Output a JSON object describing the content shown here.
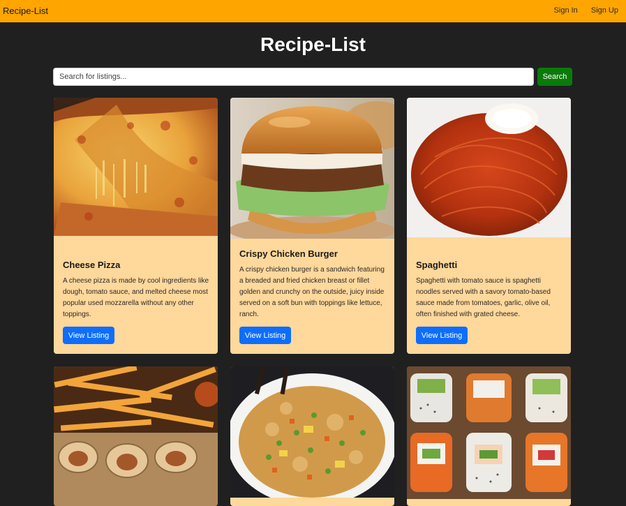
{
  "navbar": {
    "brand": "Recipe-List",
    "links": [
      "Sign In",
      "Sign Up"
    ]
  },
  "page": {
    "title": "Recipe-List"
  },
  "search": {
    "placeholder": "Search for listings...",
    "button_label": "Search"
  },
  "cards": [
    {
      "title": "Cheese Pizza",
      "description": "A cheese pizza is made by cool ingredients like dough, tomato sauce, and melted cheese most popular used mozzarella without any other toppings.",
      "button_label": "View Listing",
      "image": "pizza-photo"
    },
    {
      "title": "Crispy Chicken Burger",
      "description": "A crispy chicken burger is a sandwich featuring a breaded and fried chicken breast or fillet golden and crunchy on the outside, juicy inside served on a soft bun with toppings like lettuce, ranch.",
      "button_label": "View Listing",
      "image": "burger-photo"
    },
    {
      "title": "Spaghetti",
      "description": "Spaghetti with tomato sauce is spaghetti noodles served with a savory tomato-based sauce made from tomatoes, garlic, olive oil, often finished with grated cheese.",
      "button_label": "View Listing",
      "image": "spaghetti-photo"
    },
    {
      "image": "fries-wraps-photo"
    },
    {
      "image": "fried-rice-photo"
    },
    {
      "image": "sushi-photo"
    }
  ],
  "colors": {
    "navbar": "#ffa500",
    "background": "#202020",
    "card": "#ffd89b",
    "search_button": "#0a7a0a",
    "card_button": "#0d6efd"
  }
}
